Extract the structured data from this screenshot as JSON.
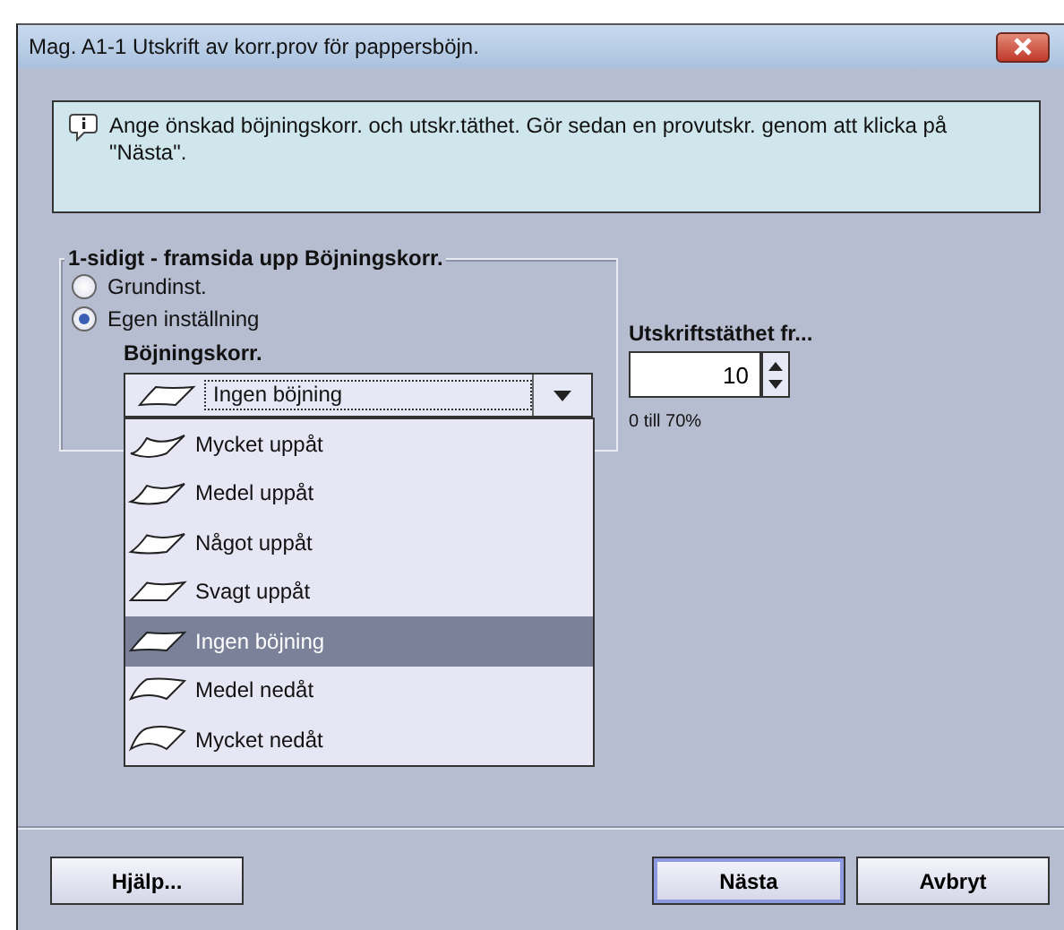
{
  "window": {
    "title": "Mag. A1-1 Utskrift av korr.prov för pappersböjn."
  },
  "info": {
    "text": "Ange önskad böjningskorr. och utskr.täthet. Gör sedan en provutskr. genom att klicka på \"Nästa\"."
  },
  "group": {
    "title": "1-sidigt - framsida upp Böjningskorr.",
    "options": [
      {
        "label": "Grundinst.",
        "selected": false
      },
      {
        "label": "Egen inställning",
        "selected": true
      }
    ],
    "combo": {
      "label": "Böjningskorr.",
      "value": "Ingen böjning",
      "expanded": true,
      "items": [
        {
          "label": "Mycket uppåt",
          "kind": "upstrong",
          "selected": false
        },
        {
          "label": "Medel uppåt",
          "kind": "upmedium",
          "selected": false
        },
        {
          "label": "Något uppåt",
          "kind": "upslight",
          "selected": false
        },
        {
          "label": "Svagt uppåt",
          "kind": "upweak",
          "selected": false
        },
        {
          "label": "Ingen böjning",
          "kind": "flat",
          "selected": true
        },
        {
          "label": "Medel nedåt",
          "kind": "downmedium",
          "selected": false
        },
        {
          "label": "Mycket nedåt",
          "kind": "downstrong",
          "selected": false
        }
      ]
    }
  },
  "density": {
    "label": "Utskriftstäthet fr...",
    "value": "10",
    "range": "0 till 70%"
  },
  "buttons": [
    {
      "label": "Hjälp...",
      "default": false
    },
    {
      "label": "Nästa",
      "default": true
    },
    {
      "label": "Avbryt",
      "default": false
    }
  ]
}
